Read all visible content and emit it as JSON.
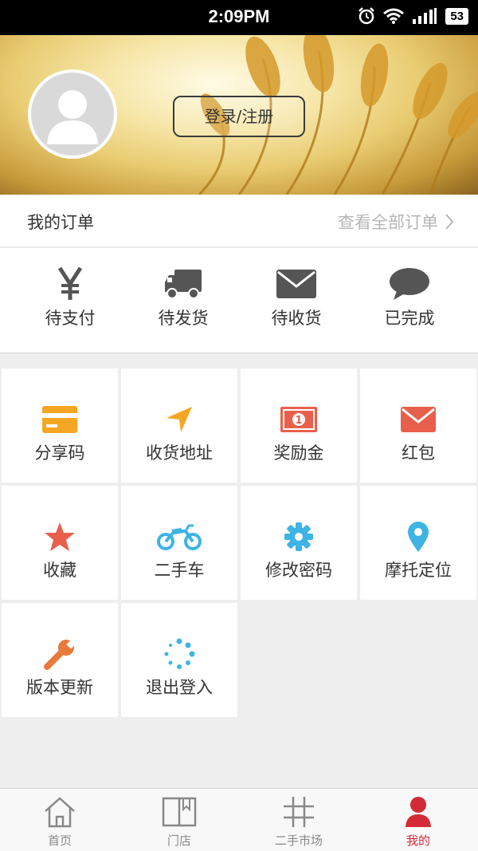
{
  "status_bar": {
    "time": "2:09PM",
    "battery": "53"
  },
  "header": {
    "login_label": "登录/注册"
  },
  "orders": {
    "title": "我的订单",
    "view_all": "查看全部订单",
    "items": [
      {
        "label": "待支付",
        "icon": "yen-icon"
      },
      {
        "label": "待发货",
        "icon": "truck-icon"
      },
      {
        "label": "待收货",
        "icon": "envelope-icon"
      },
      {
        "label": "已完成",
        "icon": "chat-bubble-icon"
      }
    ]
  },
  "grid": {
    "items": [
      {
        "label": "分享码",
        "icon": "card-icon",
        "color": "#f5a623"
      },
      {
        "label": "收货地址",
        "icon": "navigation-arrow-icon",
        "color": "#f5a623"
      },
      {
        "label": "奖励金",
        "icon": "banknote-icon",
        "color": "#e8604c"
      },
      {
        "label": "红包",
        "icon": "envelope-icon",
        "color": "#e8604c"
      },
      {
        "label": "收藏",
        "icon": "star-icon",
        "color": "#e8604c"
      },
      {
        "label": "二手车",
        "icon": "motorcycle-icon",
        "color": "#3db4e4"
      },
      {
        "label": "修改密码",
        "icon": "gear-icon",
        "color": "#3db4e4"
      },
      {
        "label": "摩托定位",
        "icon": "location-pin-icon",
        "color": "#3db4e4"
      },
      {
        "label": "版本更新",
        "icon": "wrench-icon",
        "color": "#e87a3c"
      },
      {
        "label": "退出登入",
        "icon": "loading-dots-icon",
        "color": "#3db4e4"
      }
    ]
  },
  "tabbar": {
    "items": [
      {
        "label": "首页",
        "icon": "home-icon"
      },
      {
        "label": "门店",
        "icon": "book-icon"
      },
      {
        "label": "二手市场",
        "icon": "grid-hash-icon"
      },
      {
        "label": "我的",
        "icon": "user-icon",
        "active": true
      }
    ],
    "active_color": "#d42a37"
  }
}
